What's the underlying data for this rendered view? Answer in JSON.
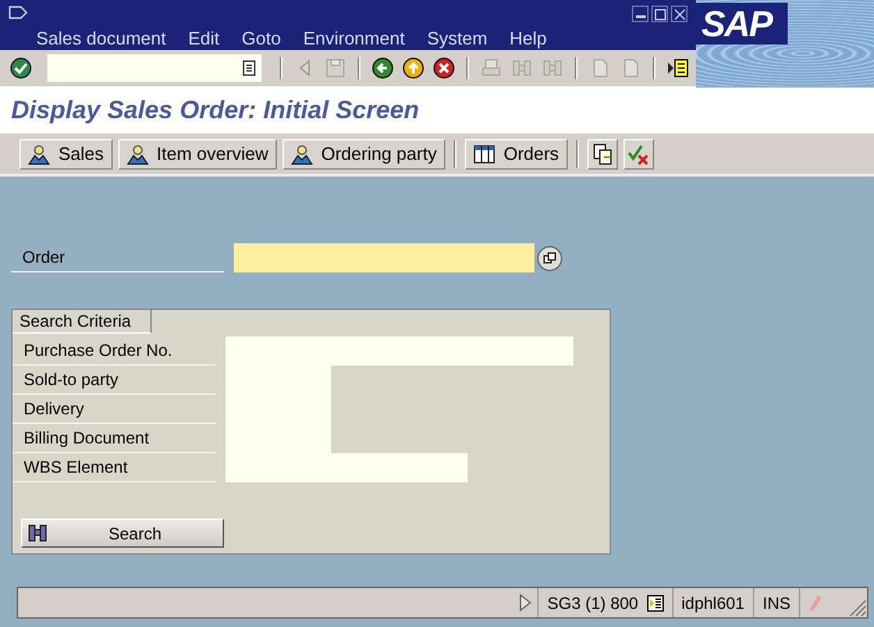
{
  "menu": [
    "Sales document",
    "Edit",
    "Goto",
    "Environment",
    "System",
    "Help"
  ],
  "toolbar": [
    {
      "kind": "enter",
      "disabled": false
    },
    {
      "kind": "sep"
    },
    {
      "kind": "triangle",
      "disabled": true
    },
    {
      "kind": "save",
      "disabled": true
    },
    {
      "kind": "sep"
    },
    {
      "kind": "back",
      "disabled": false
    },
    {
      "kind": "exit",
      "disabled": false
    },
    {
      "kind": "cancel",
      "disabled": false
    },
    {
      "kind": "sep"
    },
    {
      "kind": "print",
      "disabled": true
    },
    {
      "kind": "find",
      "disabled": true
    },
    {
      "kind": "find",
      "disabled": true
    },
    {
      "kind": "sep"
    },
    {
      "kind": "page",
      "disabled": true
    },
    {
      "kind": "page",
      "disabled": true
    },
    {
      "kind": "sep"
    },
    {
      "kind": "session",
      "disabled": false
    }
  ],
  "logo": "SAP",
  "title": "Display Sales Order: Initial Screen",
  "app_toolbar": [
    {
      "kind": "person",
      "label": "Sales"
    },
    {
      "kind": "person",
      "label": "Item overview"
    },
    {
      "kind": "person",
      "label": "Ordering party"
    },
    {
      "kind": "sep"
    },
    {
      "kind": "table",
      "label": "Orders"
    },
    {
      "kind": "sep"
    },
    {
      "kind": "copy"
    },
    {
      "kind": "checkx"
    }
  ],
  "order_field": {
    "label": "Order",
    "required": true
  },
  "search_criteria": {
    "title": "Search Criteria",
    "fields": [
      {
        "label": "Purchase Order No.",
        "required": false
      },
      {
        "label": "Sold-to party",
        "required": false
      },
      {
        "label": "Delivery",
        "required": false
      },
      {
        "label": "Billing Document",
        "required": false
      },
      {
        "label": "WBS Element",
        "required": false
      }
    ],
    "button": "Search"
  },
  "status_bar": {
    "system": "SG3 (1) 800",
    "server": "idphl601",
    "mode": "INS"
  }
}
